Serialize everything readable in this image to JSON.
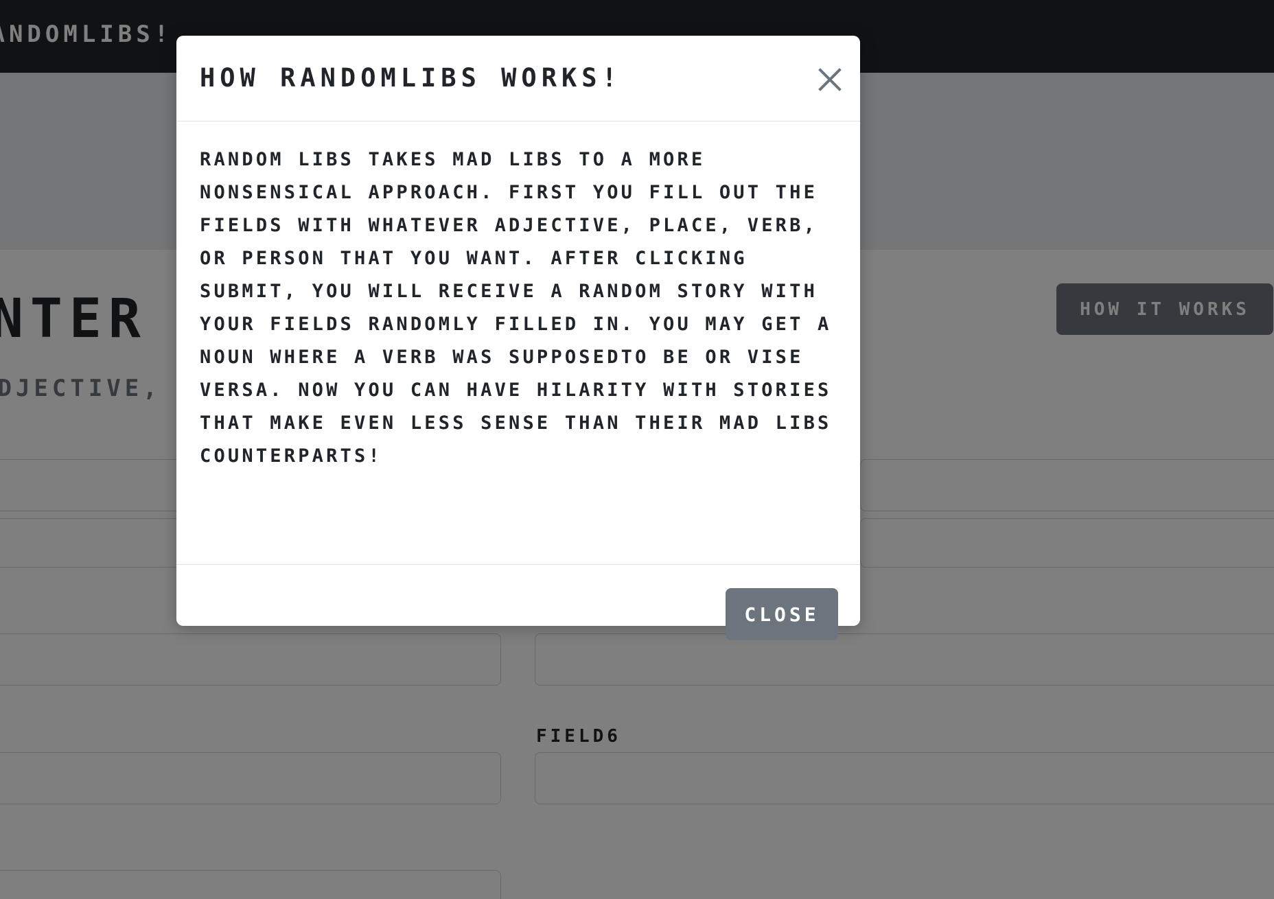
{
  "navbar": {
    "brand": "RANDOMLIBS!"
  },
  "main": {
    "title": "ENTER",
    "subtitle": "ADJECTIVE, P",
    "how_button_label": "HOW IT WORKS",
    "field6_label": "FIELD6"
  },
  "modal": {
    "title": "HOW RANDOMLIBS WORKS!",
    "body": "RANDOM LIBS TAKES MAD LIBS TO A MORE NONSENSICAL APPROACH. FIRST YOU FILL OUT THE FIELDS WITH WHATEVER ADJECTIVE, PLACE, VERB, OR PERSON THAT YOU WANT. AFTER CLICKING SUBMIT, YOU WILL RECEIVE A RANDOM STORY WITH YOUR FIELDS RANDOMLY FILLED IN. YOU MAY GET A NOUN WHERE A VERB WAS SUPPOSEDTO BE OR VISE VERSA. NOW YOU CAN HAVE HILARITY WITH STORIES THAT MAKE EVEN LESS SENSE THAN THEIR MAD LIBS COUNTERPARTS!",
    "close_button_label": "CLOSE",
    "close_icon": "close-icon"
  },
  "colors": {
    "navbar_bg": "#212529",
    "jumbotron_bg": "#e9ecef",
    "secondary": "#6c757d",
    "backdrop": "rgba(0,0,0,0.5)"
  }
}
